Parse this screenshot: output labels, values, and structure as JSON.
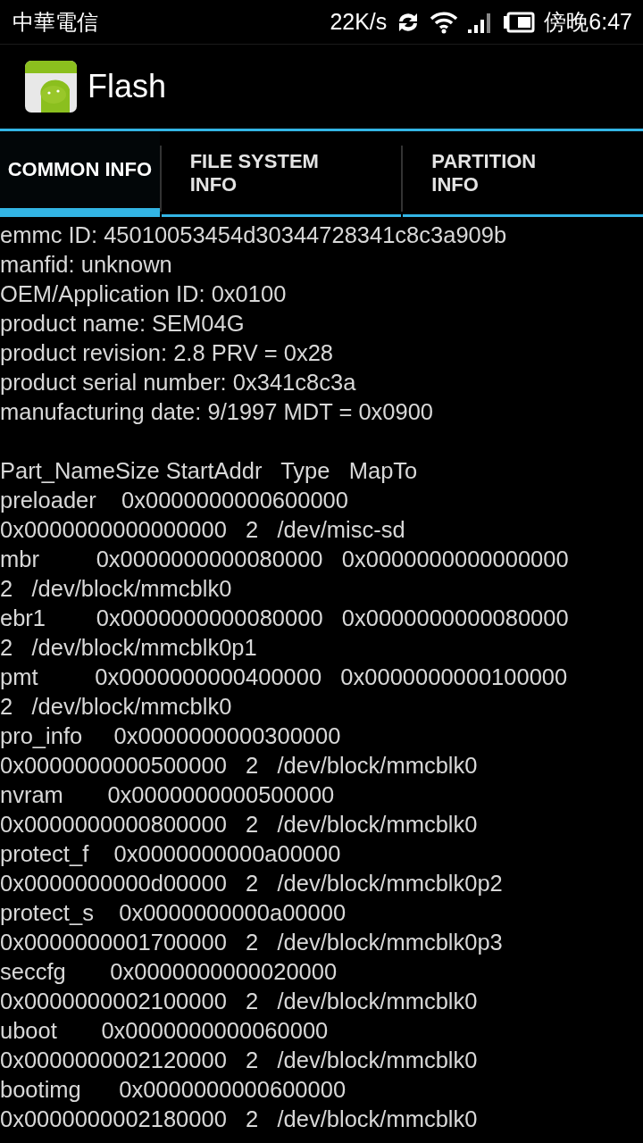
{
  "status_bar": {
    "carrier": "中華電信",
    "speed": "22K/s",
    "time": "傍晚6:47"
  },
  "app_bar": {
    "title": "Flash"
  },
  "tabs": [
    {
      "label": "COMMON INFO",
      "selected": true
    },
    {
      "label": "FILE SYSTEM INFO",
      "selected": false
    },
    {
      "label": "PARTITION INFO",
      "selected": false
    }
  ],
  "common_info": [
    "emmc ID: 45010053454d30344728341c8c3a909b",
    "manfid: unknown",
    "OEM/Application ID: 0x0100",
    "product name: SEM04G",
    "product revision: 2.8 PRV = 0x28",
    "product serial number: 0x341c8c3a",
    "manufacturing date: 9/1997 MDT = 0x0900"
  ],
  "partition_table": [
    "Part_NameSize StartAddr   Type   MapTo",
    "preloader    0x0000000000600000",
    "0x0000000000000000   2   /dev/misc-sd",
    "mbr         0x0000000000080000   0x0000000000000000",
    "2   /dev/block/mmcblk0",
    "ebr1        0x0000000000080000   0x0000000000080000",
    "2   /dev/block/mmcblk0p1",
    "pmt         0x0000000000400000   0x0000000000100000",
    "2   /dev/block/mmcblk0",
    "pro_info     0x0000000000300000",
    "0x0000000000500000   2   /dev/block/mmcblk0",
    "nvram       0x0000000000500000",
    "0x0000000000800000   2   /dev/block/mmcblk0",
    "protect_f    0x0000000000a00000",
    "0x0000000000d00000   2   /dev/block/mmcblk0p2",
    "protect_s    0x0000000000a00000",
    "0x0000000001700000   2   /dev/block/mmcblk0p3",
    "seccfg       0x0000000000020000",
    "0x0000000002100000   2   /dev/block/mmcblk0",
    "uboot       0x0000000000060000",
    "0x0000000002120000   2   /dev/block/mmcblk0",
    "bootimg      0x0000000000600000",
    "0x0000000002180000   2   /dev/block/mmcblk0"
  ]
}
